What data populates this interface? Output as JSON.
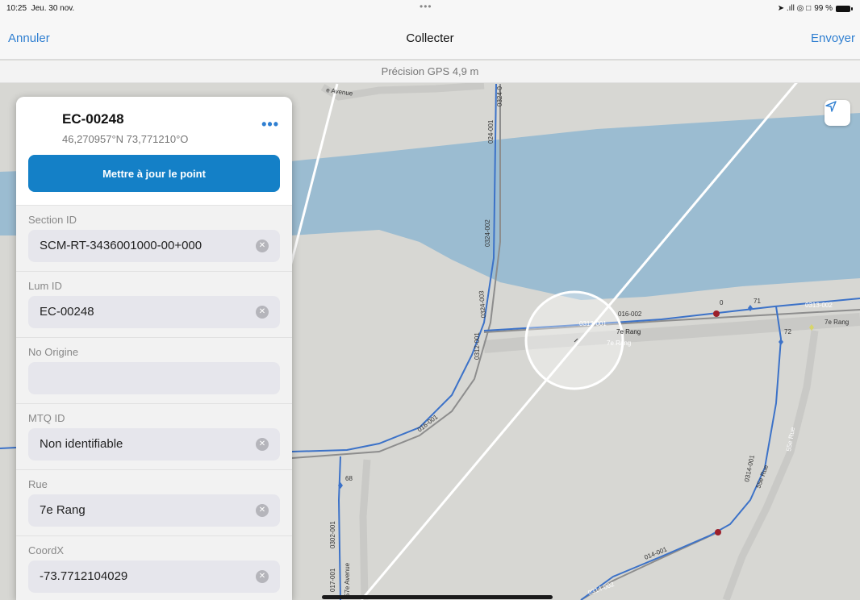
{
  "status": {
    "time": "10:25",
    "date": "Jeu. 30 nov.",
    "indicators": "➤ .ıll ◎ □",
    "battery": "99 %"
  },
  "nav": {
    "cancel": "Annuler",
    "title": "Collecter",
    "send": "Envoyer"
  },
  "gps": {
    "label": "Précision GPS 4,9 m"
  },
  "feature": {
    "id": "EC-00248",
    "coords": "46,270957°N 73,771210°O",
    "more": "•••",
    "update_button": "Mettre à jour le point"
  },
  "fields": [
    {
      "label": "Section ID",
      "value": "SCM-RT-3436001000-00+000"
    },
    {
      "label": "Lum ID",
      "value": "EC-00248"
    },
    {
      "label": "No Origine",
      "value": ""
    },
    {
      "label": "MTQ ID",
      "value": "Non identifiable"
    },
    {
      "label": "Rue",
      "value": "7e Rang"
    },
    {
      "label": "CoordX",
      "value": "-73.7712104029"
    }
  ],
  "map_labels": {
    "road_5e_avenue": "e Avenue",
    "seg_0324_top": "0324-0",
    "seg_024_001": "024-001",
    "seg_0324_002": "0324-002",
    "seg_0324_003": "0324-003",
    "seg_0312_001": "0312-001",
    "seg_016_002": "016-002",
    "seg_0313_001": "0313-001",
    "road_7e_rang_a": "7e Rang",
    "road_7e_rang_b": "7e Rang",
    "road_7e_rang_c": "7e Rang",
    "seg_0313_002": "0313-002",
    "seg_016_001": "016-001",
    "road_55e_rue_a": "55e Rue",
    "road_55e_rue_b": "55e Rue",
    "seg_0314_001": "0314-001",
    "seg_0302_001": "0302-001",
    "seg_017_001": "017-001",
    "road_57e_avenue": "57e Avenue",
    "seg_014_001": "014-001",
    "seg_0314_002": "0314-002",
    "pt_71": "71",
    "pt_72": "72",
    "pt_68": "68",
    "pt_0": "0"
  },
  "colors": {
    "accent": "#2f7fd1",
    "button": "#1480c7",
    "water": "#9bbcd1",
    "line": "#3c72c8"
  }
}
